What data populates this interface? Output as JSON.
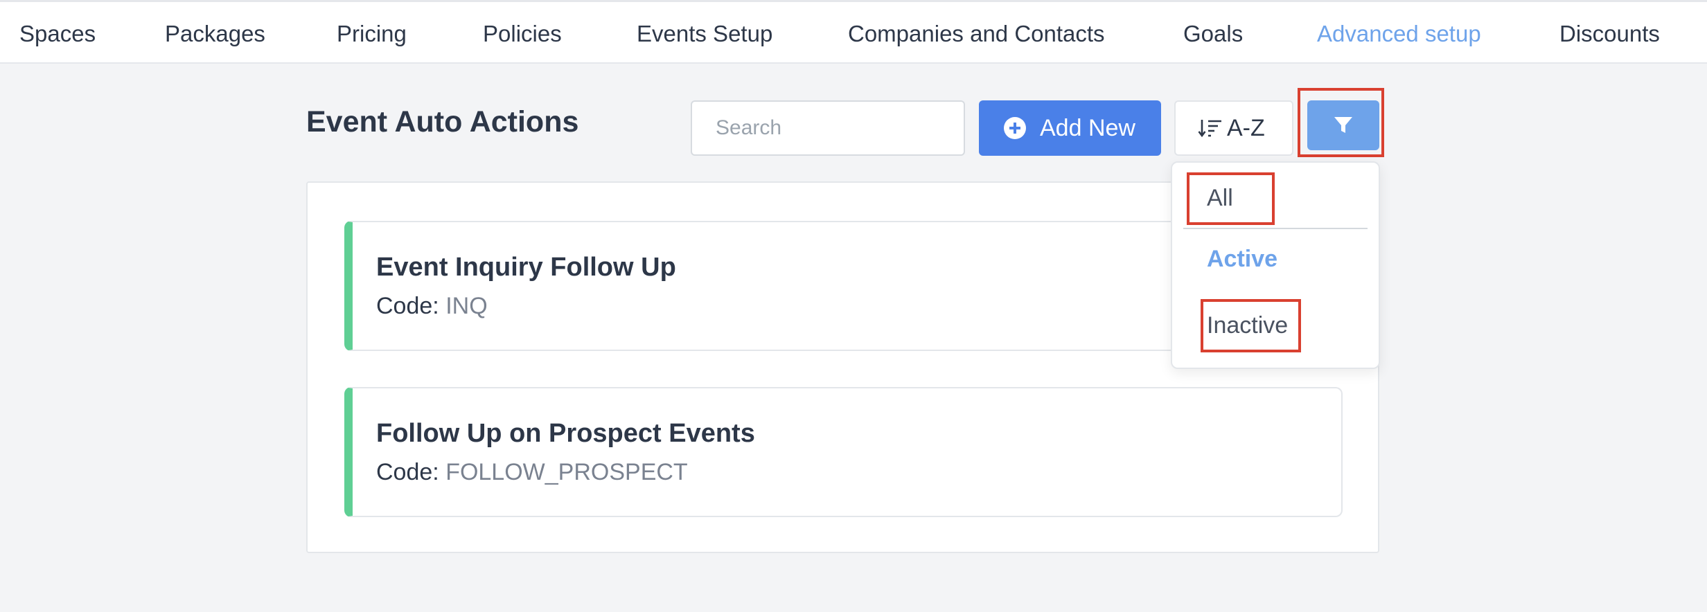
{
  "nav": {
    "items": [
      {
        "label": "Spaces"
      },
      {
        "label": "Packages"
      },
      {
        "label": "Pricing"
      },
      {
        "label": "Policies"
      },
      {
        "label": "Events Setup"
      },
      {
        "label": "Companies and Contacts"
      },
      {
        "label": "Goals"
      },
      {
        "label": "Advanced setup",
        "active": true
      },
      {
        "label": "Discounts"
      }
    ]
  },
  "page": {
    "title": "Event Auto Actions"
  },
  "toolbar": {
    "search_placeholder": "Search",
    "search_value": "",
    "add_label": "Add New",
    "add_icon": "plus-circle-icon",
    "sort_label": "A-Z",
    "sort_icon": "sort-descending-icon",
    "filter_icon": "funnel-icon"
  },
  "filter_menu": {
    "options": [
      {
        "label": "All",
        "highlighted": true
      },
      {
        "label": "Active",
        "selected": true
      },
      {
        "label": "Inactive",
        "highlighted": true
      }
    ]
  },
  "actions": [
    {
      "title": "Event Inquiry Follow Up",
      "code_label": "Code:",
      "code": "INQ"
    },
    {
      "title": "Follow Up on Prospect Events",
      "code_label": "Code:",
      "code": "FOLLOW_PROSPECT"
    }
  ],
  "colors": {
    "accent": "#4a80e8",
    "accent_light": "#6ea3ea",
    "card_status": "#5fcf94",
    "highlight_box": "#d94030"
  }
}
